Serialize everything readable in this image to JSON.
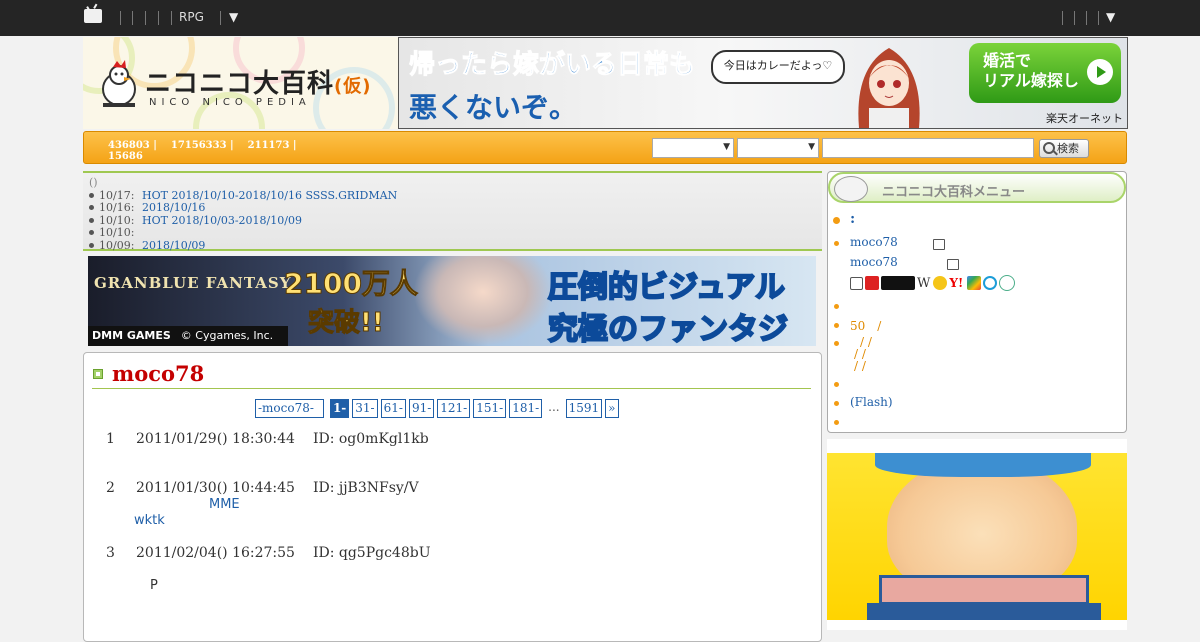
{
  "topbar": {
    "rpg_label": "RPG",
    "menu_arrow": "▼",
    "right_arrow": "▼"
  },
  "header": {
    "logo_text": "ニコニコ大百科",
    "logo_paren": "(仮)",
    "logo_sub": "NICO NICO PEDIA"
  },
  "ad_banner_top": {
    "headline": "帰ったら嫁がいる日常も",
    "subline": "悪くないぞ。",
    "bubble": "今日はカレーだよっ♡",
    "button_line1": "婚活で",
    "button_line2": "リアル嫁探し",
    "footer": "楽天オーネット"
  },
  "stats": {
    "a": "436803 |",
    "b": "17156333 |",
    "c": "211173 |",
    "d": "15686"
  },
  "search": {
    "button_label": "検索",
    "placeholder": ""
  },
  "news": {
    "head": "()",
    "items": [
      {
        "date": "10/17:",
        "text": "HOT 2018/10/10-2018/10/16 SSSS.GRIDMAN"
      },
      {
        "date": "10/16:",
        "text": "2018/10/16"
      },
      {
        "date": "10/10:",
        "text": "HOT 2018/10/03-2018/10/09"
      },
      {
        "date": "10/10:",
        "text": ""
      },
      {
        "date": "10/09:",
        "text": "2018/10/09"
      }
    ]
  },
  "ad_banner_mid": {
    "game": "GRANBLUE FANTASY",
    "big1": "2100万人",
    "big2": "突破!!",
    "right1": "圧倒的ビジュアル",
    "right2": "究極のファンタジー",
    "footer_brand": "DMM GAMES",
    "footer_copy": "© Cygames, Inc."
  },
  "article": {
    "title": "moco78",
    "pager": [
      "-moco78-",
      "1-",
      "31-",
      "61-",
      "91-",
      "121-",
      "151-",
      "181-",
      "...",
      "1591",
      "»"
    ],
    "posts": [
      {
        "num": "1",
        "datetime": "2011/01/29() 18:30:44",
        "id": "ID: og0mKgl1kb"
      },
      {
        "num": "2",
        "datetime": "2011/01/30() 10:44:45",
        "id": "ID: jjB3NFsy/V",
        "line1": "MME",
        "line2": "wktk"
      },
      {
        "num": "3",
        "datetime": "2011/02/04() 16:27:55",
        "id": "ID: qg5Pgc48bU",
        "line1": "P"
      }
    ]
  },
  "menu": {
    "title": "ニコニコ大百科メニュー",
    "colon": ":",
    "user1": "moco78",
    "user2": "moco78",
    "w_label": "W",
    "item_50": "50　/",
    "slashes1": "/ /",
    "slashes2": "/ /",
    "slashes3": "/ /",
    "flash": "(Flash)"
  },
  "colors": {
    "accent_orange": "#f4a316",
    "link_blue": "#1f5fa8",
    "title_red": "#c40000",
    "green_rule": "#a3c54f"
  }
}
